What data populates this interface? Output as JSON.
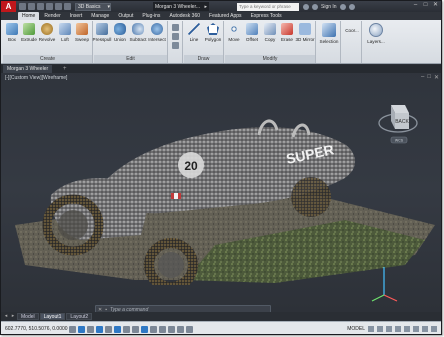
{
  "titlebar": {
    "logo_letter": "A",
    "workspace": "3D Basics",
    "document_title": "Morgan 3 Wheeler...",
    "search_placeholder": "Type a keyword or phrase",
    "sign_in": "Sign In"
  },
  "ribbon_tabs": [
    "Home",
    "Render",
    "Insert",
    "Manage",
    "Output",
    "Plug-ins",
    "Autodesk 360",
    "Featured Apps",
    "Express Tools"
  ],
  "active_tab": "Home",
  "panels": {
    "create": {
      "title": "Create",
      "tools": [
        "Box",
        "Extrude",
        "Revolve",
        "Loft",
        "Sweep"
      ]
    },
    "edit": {
      "title": "Edit",
      "tools": [
        "Presspull",
        "Union",
        "Subtract",
        "Intersect"
      ]
    },
    "draw": {
      "title": "Draw",
      "tools": [
        "Line",
        "Polygon"
      ]
    },
    "modify": {
      "title": "Modify",
      "tools": [
        "Move",
        "Offset",
        "Copy",
        "Erase",
        "3D Mirror"
      ]
    },
    "selection": {
      "label": "Selection"
    },
    "coordinates": {
      "label": "Coor..."
    },
    "layers": {
      "label": "Layers..."
    }
  },
  "file_tab": "Morgan 3 Wheeler",
  "viewport": {
    "label": "[-][Custom View][Wireframe]",
    "viewcube_face": "BACK",
    "viewcube_sub": "WCS",
    "car_text": "SUPER",
    "car_number": "20"
  },
  "layout_tabs": [
    "Model",
    "Layout1",
    "Layout2"
  ],
  "active_layout": "Layout1",
  "command_prompt": "Type a command",
  "status": {
    "coordinates": "602.7770, 510.5076, 0.0000",
    "model_label": "MODEL"
  },
  "colors": {
    "accent": "#2f78c4",
    "app_logo": "#c0171b",
    "viewport_bg": "#33383f"
  }
}
